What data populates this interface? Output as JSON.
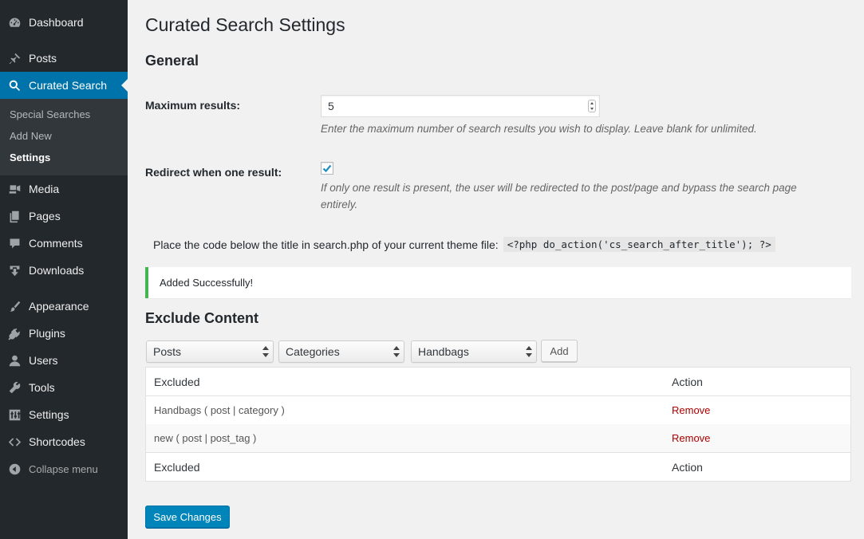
{
  "sidebar": {
    "items": [
      {
        "label": "Dashboard",
        "icon": "dashboard-icon"
      },
      {
        "label": "Posts",
        "icon": "pin-icon"
      },
      {
        "label": "Curated Search",
        "icon": "search-icon"
      },
      {
        "label": "Media",
        "icon": "media-icon"
      },
      {
        "label": "Pages",
        "icon": "pages-icon"
      },
      {
        "label": "Comments",
        "icon": "comment-icon"
      },
      {
        "label": "Downloads",
        "icon": "download-icon"
      },
      {
        "label": "Appearance",
        "icon": "paintbrush-icon"
      },
      {
        "label": "Plugins",
        "icon": "plugin-icon"
      },
      {
        "label": "Users",
        "icon": "user-icon"
      },
      {
        "label": "Tools",
        "icon": "wrench-icon"
      },
      {
        "label": "Settings",
        "icon": "settings-icon"
      },
      {
        "label": "Shortcodes",
        "icon": "code-icon"
      }
    ],
    "submenu": [
      "Special Searches",
      "Add New",
      "Settings"
    ],
    "collapse_label": "Collapse menu"
  },
  "page": {
    "title": "Curated Search Settings",
    "general_heading": "General",
    "max_results": {
      "label": "Maximum results:",
      "value": "5",
      "description": "Enter the maximum number of search results you wish to display. Leave blank for unlimited."
    },
    "redirect": {
      "label": "Redirect when one result:",
      "checked": true,
      "description_line1": "If only one result is present, the user will be redirected to the post/page and bypass the search page",
      "description_line2": "entirely."
    },
    "code_instruction": "Place the code below the title in search.php of your current theme file:",
    "code_snippet": "<?php do_action('cs_search_after_title'); ?>",
    "notice": "Added Successfully!",
    "exclude_heading": "Exclude Content",
    "selects": [
      "Posts",
      "Categories",
      "Handbags"
    ],
    "add_button": "Add",
    "table": {
      "columns": [
        "Excluded",
        "Action"
      ],
      "rows": [
        {
          "excluded": "Handbags ( post | category )",
          "action": "Remove"
        },
        {
          "excluded": "new ( post | post_tag )",
          "action": "Remove"
        }
      ]
    },
    "save_button": "Save Changes"
  },
  "colors": {
    "sidebar_bg": "#23282d",
    "active_bg": "#0073aa",
    "primary_button": "#0085ba",
    "success": "#46b450",
    "remove_link": "#aa0000"
  }
}
